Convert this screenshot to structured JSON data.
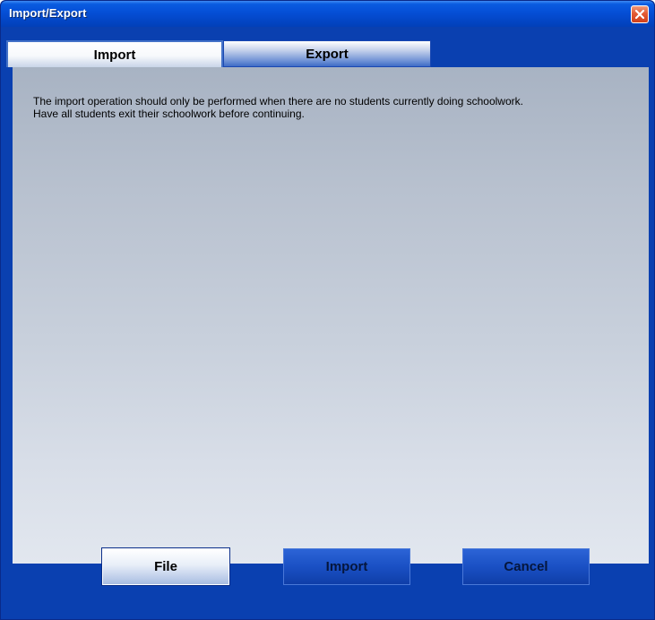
{
  "window": {
    "title": "Import/Export"
  },
  "tabs": [
    {
      "label": "Import",
      "selected": true
    },
    {
      "label": "Export",
      "selected": false
    }
  ],
  "content": {
    "message_line1": "The import operation should only be performed when there are no students currently doing schoolwork.",
    "message_line2": "Have all students exit their schoolwork before continuing."
  },
  "buttons": {
    "file": "File",
    "import": "Import",
    "cancel": "Cancel"
  },
  "icons": {
    "close": "close-icon"
  },
  "colors": {
    "titlebar": "#0550d8",
    "frame": "#0a40b0",
    "close": "#e25b35"
  }
}
